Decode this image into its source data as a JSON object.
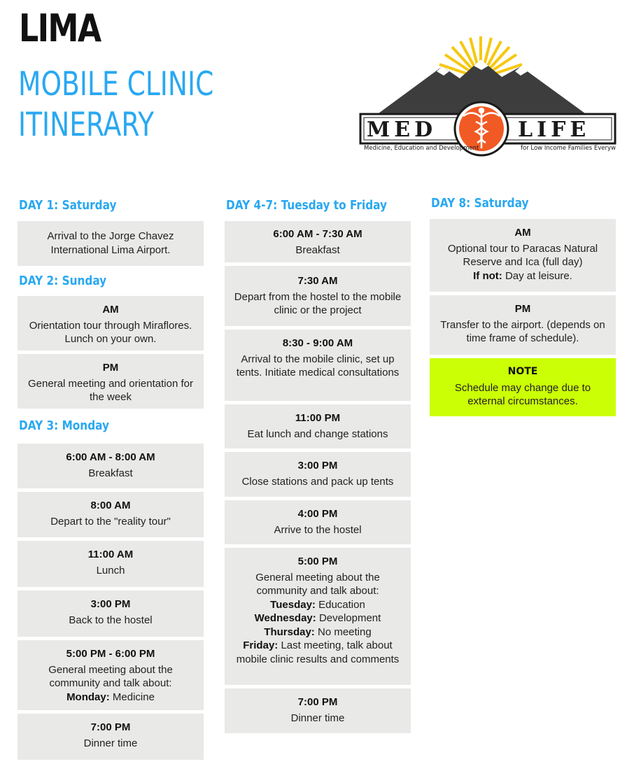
{
  "header": {
    "city": "LIMA",
    "line1": "MOBILE CLINIC",
    "line2": "ITINERARY"
  },
  "logo": {
    "left_word": "MED",
    "right_word": "LIFE",
    "tagline_left": "Medicine, Education and Development",
    "tagline_right": "for Low Income Families Everyw",
    "colors": {
      "sun": "#f6c80f",
      "mountain": "#3d3d3d",
      "badge": "#f15a24"
    }
  },
  "accent_color": "#29a8f1",
  "note_color": "#cbff05",
  "day1": {
    "heading": "DAY 1: Saturday",
    "arrival": "Arrival to the Jorge Chavez International Lima Airport."
  },
  "day2": {
    "heading": "DAY 2: Sunday",
    "am_time": "AM",
    "am_text": "Orientation tour through Miraflores. Lunch on your own.",
    "pm_time": "PM",
    "pm_text": "General meeting and orientation for the week"
  },
  "day3": {
    "heading": "DAY 3: Monday",
    "s1_time": "6:00 AM - 8:00 AM",
    "s1_text": "Breakfast",
    "s2_time": "8:00 AM",
    "s2_text": "Depart to the \"reality tour\"",
    "s3_time": "11:00 AM",
    "s3_text": "Lunch",
    "s4_time": "3:00 PM",
    "s4_text": "Back to the hostel",
    "s5_time": "5:00 PM - 6:00 PM",
    "s5_text": "General meeting about the community and talk about:",
    "s5_day": "Monday:",
    "s5_topic": "Medicine",
    "s6_time": "7:00 PM",
    "s6_text": "Dinner time"
  },
  "day47": {
    "heading": "DAY 4-7: Tuesday to Friday",
    "s1_time": "6:00 AM - 7:30 AM",
    "s1_text": "Breakfast",
    "s2_time": "7:30 AM",
    "s2_text": "Depart from the hostel to the mobile clinic or the project",
    "s3_time": "8:30 - 9:00 AM",
    "s3_text": "Arrival to the mobile clinic, set up tents. Initiate medical consultations",
    "s4_time": "11:00 PM",
    "s4_text": "Eat lunch and change stations",
    "s5_time": "3:00 PM",
    "s5_text": "Close stations and pack up tents",
    "s6_time": "4:00 PM",
    "s6_text": "Arrive to the hostel",
    "s7_time": "5:00 PM",
    "s7_text": "General meeting about the community and talk about:",
    "s7_tue": "Tuesday:",
    "s7_tue_topic": "Education",
    "s7_wed": "Wednesday:",
    "s7_wed_topic": "Development",
    "s7_thu": "Thursday:",
    "s7_thu_topic": "No meeting",
    "s7_fri": "Friday:",
    "s7_fri_topic": "Last meeting, talk about mobile clinic results and comments",
    "s8_time": "7:00 PM",
    "s8_text": "Dinner time"
  },
  "day8": {
    "heading": "DAY 8: Saturday",
    "am_time": "AM",
    "am_text": "Optional tour to Paracas Natural Reserve and Ica (full day)",
    "am_ifnot": "If not:",
    "am_ifnot_text": "Day at leisure.",
    "pm_time": "PM",
    "pm_text": "Transfer to the airport. (depends on time frame of schedule).",
    "note_title": "NOTE",
    "note_text": "Schedule may change due to external circumstances."
  }
}
